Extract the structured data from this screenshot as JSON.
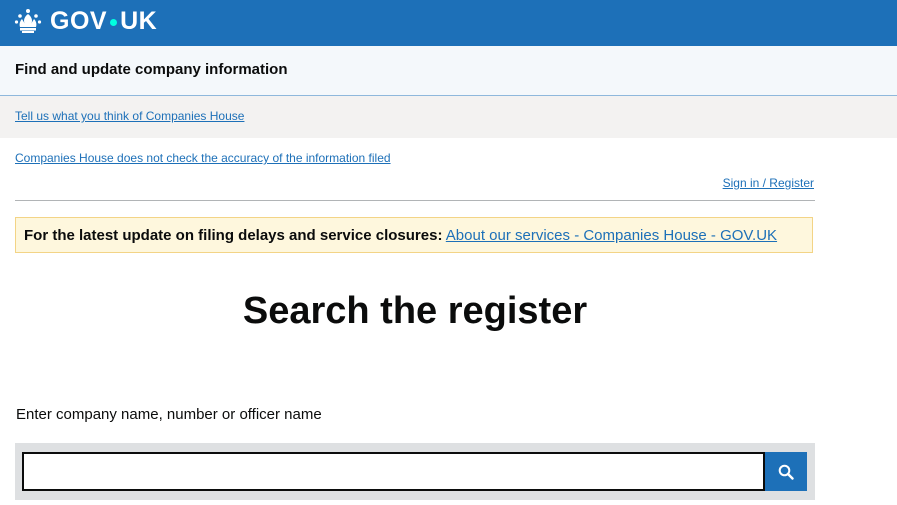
{
  "header": {
    "logo_text_left": "GOV",
    "logo_text_right": "UK",
    "logo_icon": "crown-icon",
    "brand_color": "#1d70b8",
    "dot_color": "#00ffe0"
  },
  "service": {
    "name": "Find and update company information"
  },
  "feedback": {
    "link_text": "Tell us what you think of Companies House"
  },
  "notices": {
    "accuracy_link": "Companies House does not check the accuracy of the information filed",
    "signin_link": "Sign in / Register",
    "banner_strong": "For the latest update on filing delays and service closures:",
    "banner_link": "About our services - Companies House - GOV.UK"
  },
  "main": {
    "title": "Search the register",
    "search_label": "Enter company name, number or officer name",
    "search_value": "",
    "search_button_icon": "search-icon"
  }
}
